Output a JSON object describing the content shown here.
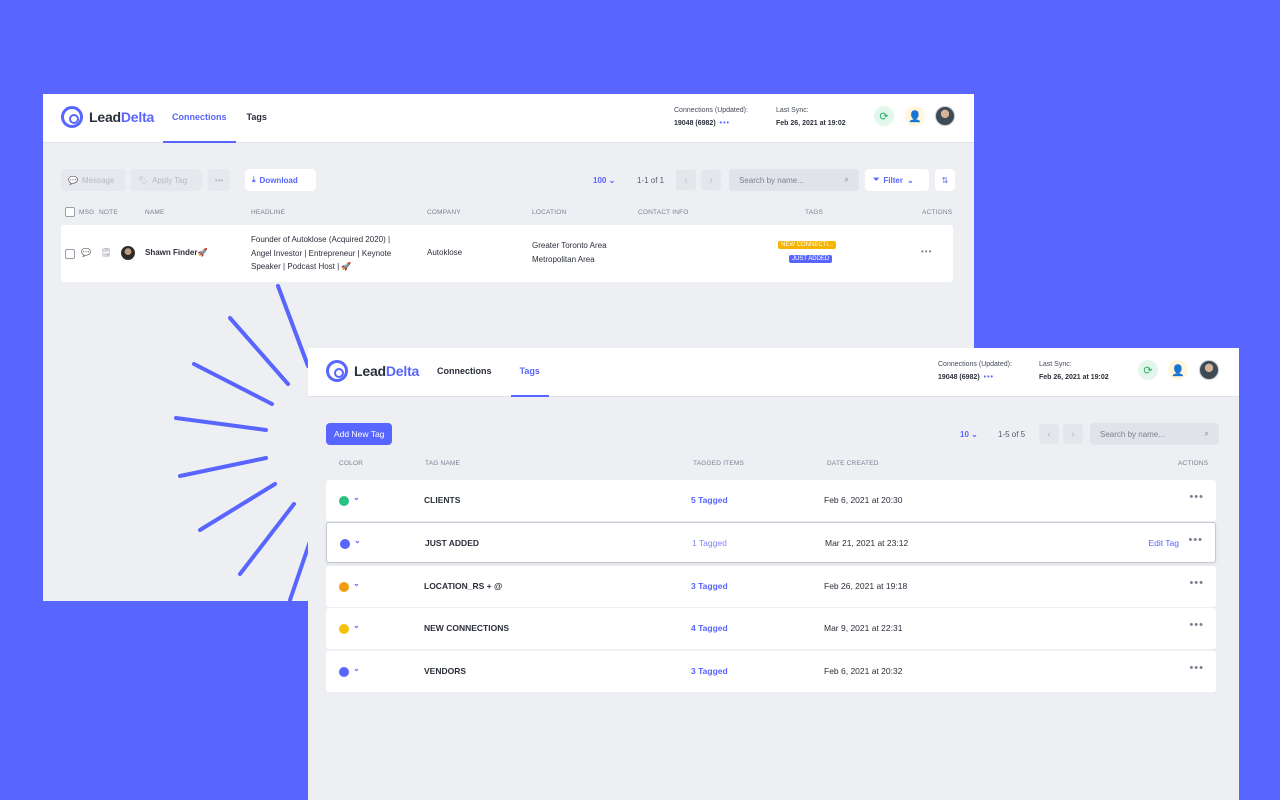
{
  "brand": {
    "lead": "Lead",
    "delta": "Delta"
  },
  "colors": {
    "background": "#5865fe",
    "accent": "#5865fe"
  },
  "connections_window": {
    "nav": [
      {
        "label": "Connections",
        "active": true
      },
      {
        "label": "Tags",
        "active": false
      }
    ],
    "stats": {
      "connections_label": "Connections (Updated):",
      "connections_value": "19048 (6982)",
      "connections_dots": "•••",
      "sync_label": "Last Sync:",
      "sync_value": "Feb 26, 2021 at 19:02"
    },
    "toolbar": {
      "message": "Message",
      "apply_tag": "Apply Tag",
      "more": "•••",
      "download": "Download",
      "page_size": "100",
      "page_count": "1-1 of 1",
      "search_placeholder": "Search by name...",
      "filter": "Filter"
    },
    "columns": [
      "MSG",
      "NOTE",
      "NAME",
      "HEADLINE",
      "COMPANY",
      "LOCATION",
      "CONTACT INFO",
      "TAGS",
      "ACTIONS"
    ],
    "rows": [
      {
        "name": "Shawn Finder🚀",
        "headline_1": "Founder of Autoklose (Acquired 2020) |",
        "headline_2": "Angel Investor | Entrepreneur | Keynote",
        "headline_3": "Speaker | Podcast Host | 🚀",
        "company": "Autoklose",
        "location_1": "Greater Toronto Area",
        "location_2": "Metropolitan Area",
        "tags": [
          {
            "label": "NEW CONNECTI...",
            "color": "#f4b400"
          },
          {
            "label": "JUST ADDED",
            "color": "#5865fe"
          }
        ],
        "actions": "•••"
      }
    ]
  },
  "tags_window": {
    "nav": [
      {
        "label": "Connections",
        "active": false
      },
      {
        "label": "Tags",
        "active": true
      }
    ],
    "stats": {
      "connections_label": "Connections (Updated):",
      "connections_value": "19048 (6982)",
      "connections_dots": "•••",
      "sync_label": "Last Sync:",
      "sync_value": "Feb 26, 2021 at 19:02"
    },
    "toolbar": {
      "add_new_tag": "Add New Tag",
      "page_size": "10",
      "page_count": "1-5 of 5",
      "search_placeholder": "Search by name..."
    },
    "columns": [
      "COLOR",
      "TAG NAME",
      "TAGGED ITEMS",
      "DATE CREATED",
      "ACTIONS"
    ],
    "rows": [
      {
        "color": "#27c281",
        "name": "CLIENTS",
        "tagged": "5 Tagged",
        "date": "Feb 6, 2021 at 20:30",
        "edit": ""
      },
      {
        "color": "#5865fe",
        "name": "JUST ADDED",
        "tagged": "1 Tagged",
        "date": "Mar 21, 2021 at 23:12",
        "edit": "Edit Tag"
      },
      {
        "color": "#f39c12",
        "name": "LOCATION_RS + @",
        "tagged": "3 Tagged",
        "date": "Feb 26, 2021 at 19:18",
        "edit": ""
      },
      {
        "color": "#f4c20d",
        "name": "NEW CONNECTIONS",
        "tagged": "4 Tagged",
        "date": "Mar 9, 2021 at 22:31",
        "edit": ""
      },
      {
        "color": "#5865fe",
        "name": "VENDORS",
        "tagged": "3 Tagged",
        "date": "Feb 6, 2021 at 20:32",
        "edit": ""
      }
    ],
    "more": "•••"
  }
}
